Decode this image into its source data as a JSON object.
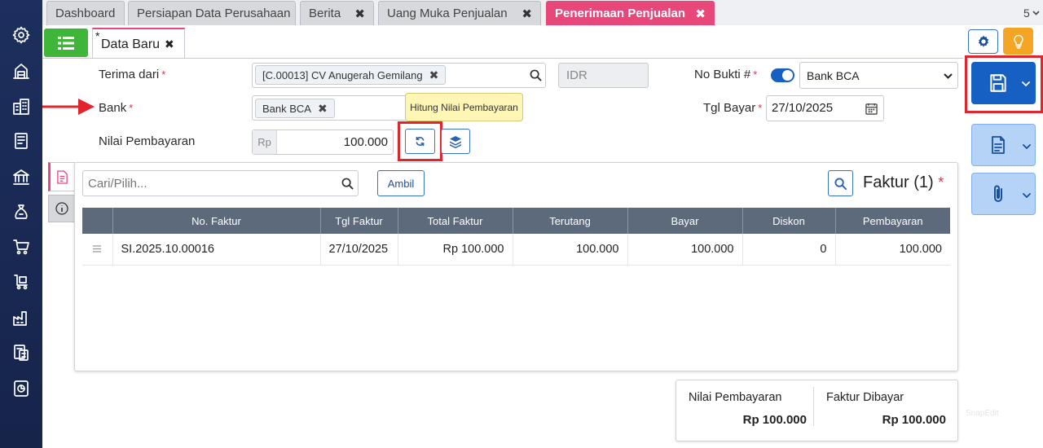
{
  "tabs": [
    {
      "label": "Dashboard",
      "closable": false
    },
    {
      "label": "Persiapan Data Perusahaan",
      "closable": false
    },
    {
      "label": "Berita",
      "closable": true
    },
    {
      "label": "Uang Muka Penjualan",
      "closable": true
    },
    {
      "label": "Penerimaan Penjualan",
      "closable": true,
      "active": true
    }
  ],
  "tab_overflow_count": "5",
  "tab_close_glyph": "✖",
  "doc_tab": {
    "modified_mark": "*",
    "label": "Data Baru",
    "close": "✖"
  },
  "form": {
    "terima_dari": {
      "label": "Terima dari",
      "required": "*",
      "value": "[C.00013] CV Anugerah Gemilang",
      "remove": "✖"
    },
    "currency": {
      "placeholder": "IDR"
    },
    "bank": {
      "label": "Bank",
      "required": "*",
      "value": "Bank BCA",
      "remove": "✖"
    },
    "nilai_pembayaran": {
      "label": "Nilai Pembayaran",
      "prefix": "Rp",
      "value": "100.000"
    },
    "no_bukti": {
      "label": "No Bukti #",
      "required": "*",
      "toggle_on": true,
      "select_value": "Bank BCA"
    },
    "tgl_bayar": {
      "label": "Tgl Bayar",
      "required": "*",
      "value": "27/10/2025"
    }
  },
  "tooltip": "Hitung Nilai Pembayaran",
  "detail": {
    "search_placeholder": "Cari/Pilih...",
    "ambil_label": "Ambil",
    "section_title": "Faktur (1)",
    "section_required": "*",
    "columns": [
      "No. Faktur",
      "Tgl Faktur",
      "Total Faktur",
      "Terutang",
      "Bayar",
      "Diskon",
      "Pembayaran"
    ],
    "rows": [
      {
        "no_faktur": "SI.2025.10.00016",
        "tgl_faktur": "27/10/2025",
        "total_faktur": "Rp 100.000",
        "terutang": "100.000",
        "bayar": "100.000",
        "diskon": "0",
        "pembayaran": "100.000"
      }
    ]
  },
  "summary": {
    "nilai_pembayaran_label": "Nilai Pembayaran",
    "nilai_pembayaran_value": "Rp 100.000",
    "faktur_dibayar_label": "Faktur Dibayar",
    "faktur_dibayar_value": "Rp 100.000"
  },
  "watermark": "SnapEdit",
  "colors": {
    "accent_pink": "#e8477a",
    "accent_green": "#3fb63a",
    "primary_blue": "#1660c4",
    "highlight_red": "#e1252c",
    "nav_bg": "#1d2f5e"
  },
  "icons": {
    "rail": [
      "settings-icon",
      "warehouse-icon",
      "building-icon",
      "ledger-icon",
      "bank-icon",
      "cash-bag-icon",
      "cart-icon",
      "delivery-cart-icon",
      "factory-icon",
      "tax-doc-icon",
      "report-icon"
    ]
  }
}
